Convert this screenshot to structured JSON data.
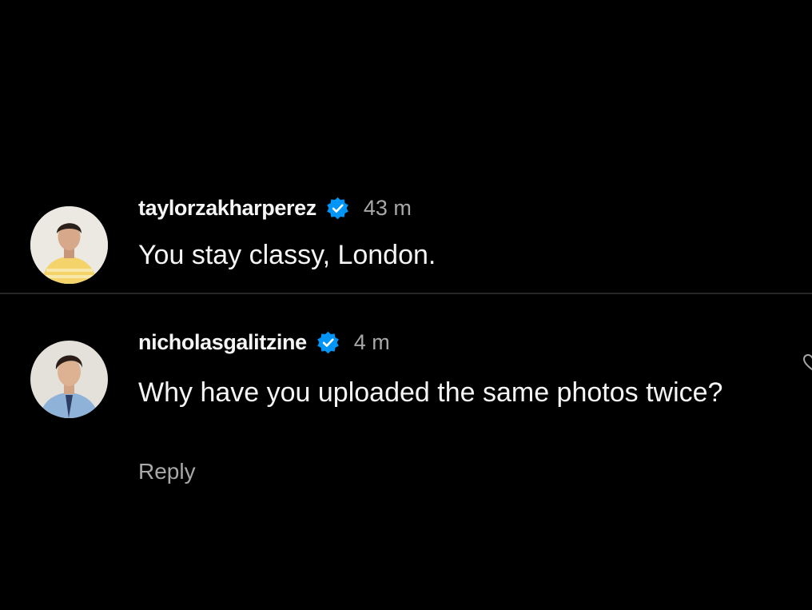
{
  "comments": [
    {
      "username": "taylorzakharperez",
      "verified": true,
      "time": "43 m",
      "text": "You stay classy, London.",
      "avatar_icon": "profile-photo"
    },
    {
      "username": "nicholasgalitzine",
      "verified": true,
      "time": "4 m",
      "text": "Why have you uploaded the same photos twice?",
      "reply_label": "Reply",
      "avatar_icon": "profile-photo"
    }
  ],
  "colors": {
    "background": "#000000",
    "primary_text": "#f5f5f5",
    "secondary_text": "#a8a8a8",
    "verified_badge": "#0095f6",
    "divider": "#262626"
  },
  "icons": {
    "verified": "verified-badge-icon",
    "like": "heart-icon"
  }
}
